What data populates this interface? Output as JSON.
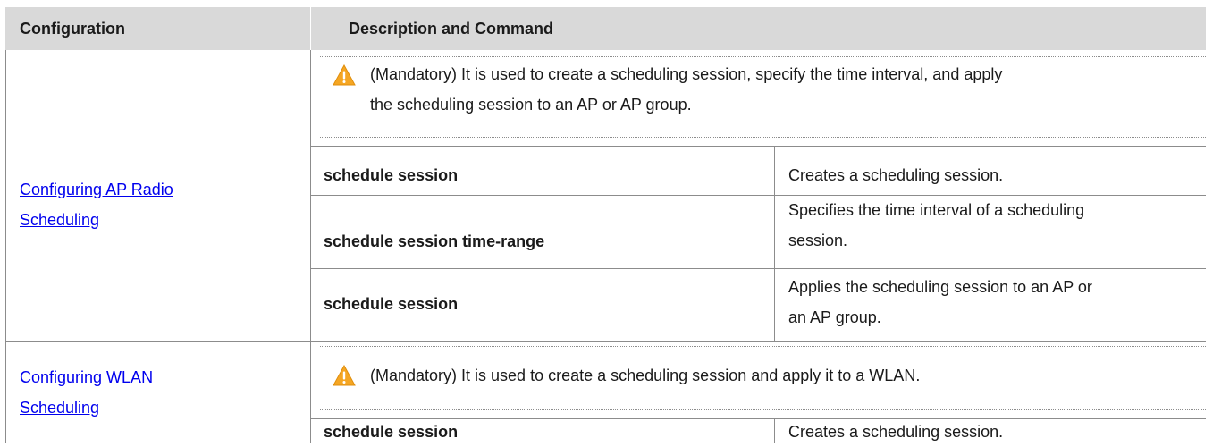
{
  "headers": {
    "configuration": "Configuration",
    "description": "Description and Command"
  },
  "sections": [
    {
      "link_line1": "Configuring AP Radio ",
      "link_line2": "Scheduling",
      "note_line1": "(Mandatory) It is used to create a scheduling session, specify the time interval, and apply",
      "note_line2": "the scheduling session to an AP or AP group.",
      "rows": [
        {
          "command": "schedule session",
          "desc_line1": "Creates a scheduling session.",
          "desc_line2": ""
        },
        {
          "command": "schedule session time-range",
          "desc_line1": "Specifies the time interval of a scheduling",
          "desc_line2": "session."
        },
        {
          "command": "schedule session",
          "desc_line1": "Applies the scheduling session to an AP or",
          "desc_line2": "an AP group."
        }
      ]
    },
    {
      "link_line1": "Configuring WLAN ",
      "link_line2": "Scheduling",
      "note_line1": "(Mandatory) It is used to create a scheduling session and apply it to a WLAN.",
      "rows": [
        {
          "command": "schedule session",
          "desc_line1": "Creates a scheduling session."
        }
      ]
    }
  ],
  "colors": {
    "header_bg": "#d9d9d9",
    "link": "#0000ee",
    "warning": "#f5a623"
  },
  "icons": {
    "warning": "warning-triangle-icon"
  }
}
